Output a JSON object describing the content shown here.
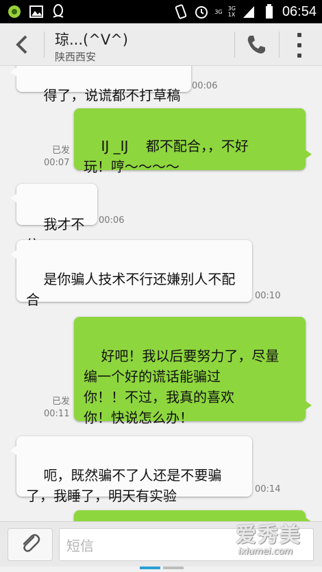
{
  "status_bar": {
    "net_top": "3G",
    "net_mid": "3G",
    "net_bot": "1X",
    "time": "06:54"
  },
  "header": {
    "contact_name": "琼...(^V^)",
    "contact_location": "陕西西安"
  },
  "messages": [
    {
      "direction": "in",
      "text": "得了，说谎都不打草稿",
      "time": "00:06"
    },
    {
      "direction": "out",
      "text": "IJ _IJ    都不配合，，不好\n玩！哼～～～～",
      "status": "已发",
      "time": "00:07"
    },
    {
      "direction": "in",
      "text": "我才不信",
      "time": "00:06"
    },
    {
      "direction": "in",
      "text": "是你骗人技术不行还嫌别人不配\n合",
      "time": "00:10"
    },
    {
      "direction": "out",
      "text": "好吧！我以后要努力了，尽量\n编一个好的谎话能骗过\n你！！不过，我真的喜欢\n你！快说怎么办！",
      "status": "已发",
      "time": "00:11"
    },
    {
      "direction": "in",
      "text": "呃，既然骗不了人还是不要骗\n了，我睡了，明天有实验",
      "time": "00:14"
    },
    {
      "direction": "out",
      "text": ""
    }
  ],
  "input": {
    "placeholder": "短信"
  },
  "watermark": {
    "cn": "爱秀美",
    "en": "ixiumei.com"
  },
  "colors": {
    "outgoing_bubble": "#8ed63e",
    "incoming_bubble": "#fbfbfb",
    "accent": "#2a9fd6"
  },
  "icons": [
    "app-notification-icon",
    "image-icon",
    "qq-icon",
    "vibrate-icon",
    "alarm-icon",
    "signal-icon",
    "battery-icon",
    "back-arrow-icon",
    "phone-icon",
    "overflow-menu-icon",
    "paperclip-icon"
  ]
}
